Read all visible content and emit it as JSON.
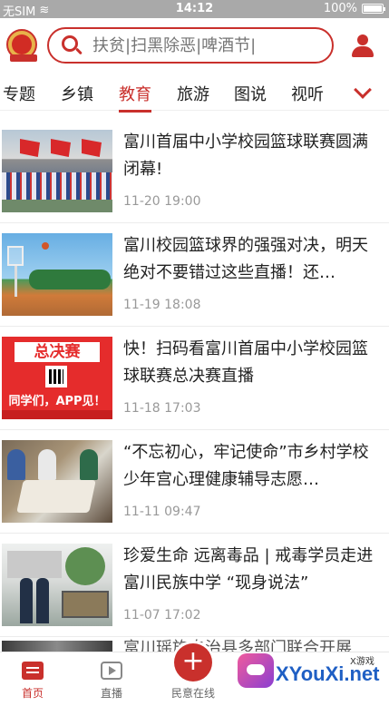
{
  "status_bar": {
    "carrier": "无SIM",
    "time": "14:12",
    "battery": "100%"
  },
  "search": {
    "placeholder": "扶贫|扫黑除恶|啤酒节|"
  },
  "tabs": [
    {
      "label": "专题"
    },
    {
      "label": "乡镇"
    },
    {
      "label": "教育",
      "active": true
    },
    {
      "label": "旅游"
    },
    {
      "label": "图说"
    },
    {
      "label": "视听"
    }
  ],
  "news": [
    {
      "title": "富川首届中小学校园篮球联赛圆满闭幕!",
      "date": "11-20 19:00"
    },
    {
      "title": "富川校园篮球界的强强对决，明天绝对不要错过这些直播！还…",
      "date": "11-19 18:08"
    },
    {
      "title": "快！扫码看富川首届中小学校园篮球联赛总决赛直播",
      "date": "11-18 17:03"
    },
    {
      "title": "“不忘初心，牢记使命”市乡村学校少年宫心理健康辅导志愿…",
      "date": "11-11 09:47"
    },
    {
      "title": "珍爱生命 远离毒品 | 戒毒学员走进富川民族中学 “现身说法”",
      "date": "11-07 17:02"
    },
    {
      "title": "富川瑶族自治县多部门联合开展",
      "date": ""
    }
  ],
  "thumb3": {
    "banner": "总决赛",
    "slogan": "同学们，APP见！"
  },
  "bottom_nav": {
    "home": "首页",
    "live": "直播",
    "center": "民意在线",
    "center_symbol": "+"
  },
  "watermark": {
    "text": "XYouXi.net",
    "badge": "X游戏"
  },
  "colors": {
    "accent": "#c9302c",
    "status_bar": "#a9a9a9"
  }
}
